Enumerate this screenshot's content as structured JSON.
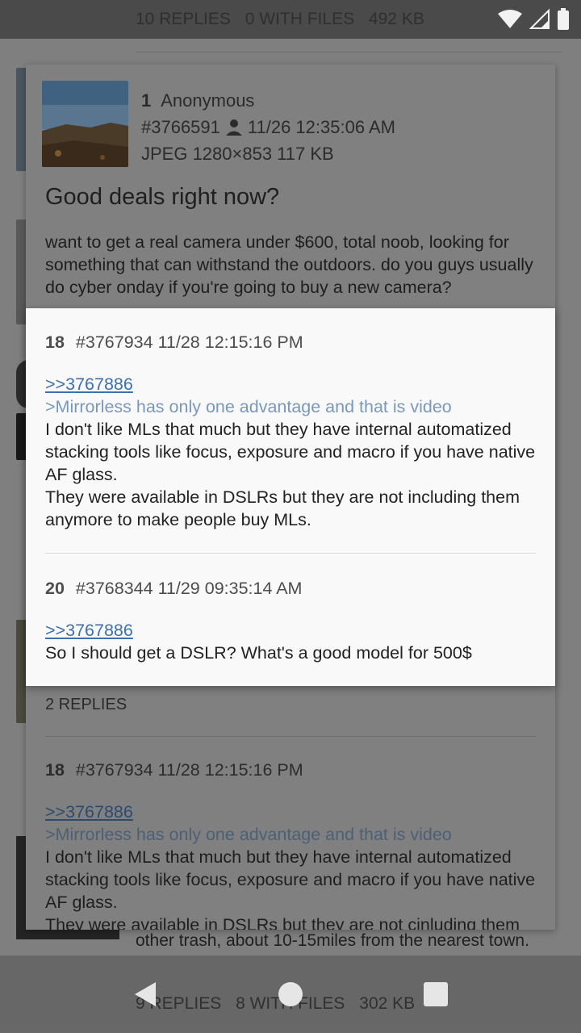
{
  "status_bar": {
    "thread_stats": {
      "replies": "10 REPLIES",
      "with_files": "0 WITH FILES",
      "size": "492 KB"
    },
    "icons": [
      "wifi-icon",
      "cell-signal-icon",
      "battery-icon"
    ]
  },
  "op_post": {
    "number": "1",
    "name": "Anonymous",
    "post_id": "#3766591",
    "datetime": "11/26 12:35:06 AM",
    "file_info": "JPEG 1280×853 117 KB",
    "subject": "Good deals right now?",
    "body": "want to get a real camera under $600, total noob, looking for something that can withstand the outdoors. do you guys usually do cyber onday if you're going to buy a new camera?"
  },
  "replies_dialog": {
    "replies_label": "2 REPLIES",
    "posts": [
      {
        "number": "18",
        "post_id": "#3767934",
        "datetime": "11/28 12:15:16 PM",
        "quote_link": ">>3767886",
        "greentext": ">Mirrorless has only one advantage and that is video",
        "text_1": "I don't like MLs that much but they have internal automatized stacking tools like focus, exposure and macro if you have native AF glass.",
        "text_2": "They were available in DSLRs but they are not cinluding them anymore to make people buy MLs."
      }
    ]
  },
  "popup": {
    "posts": [
      {
        "number": "18",
        "post_id": "#3767934",
        "datetime": "11/28 12:15:16 PM",
        "quote_link": ">>3767886",
        "greentext": ">Mirrorless has only one advantage and that is video",
        "text_1": "I don't like MLs that much but they have internal automatized stacking tools like focus, exposure and macro if you have native AF glass.",
        "text_2": "They were available in DSLRs but they are not including them anymore to make people buy MLs."
      },
      {
        "number": "20",
        "post_id": "#3768344",
        "datetime": "11/29 09:35:14 AM",
        "quote_link": ">>3767886",
        "text_1": "So I should get a DSLR? What's a good model for 500$"
      }
    ]
  },
  "background_thread": {
    "snippet": "other trash, about 10-15miles from the nearest town.",
    "stats": {
      "replies": "9 REPLIES",
      "with_files": "8 WITH FILES",
      "size": "302 KB"
    }
  },
  "nav_bar": {
    "buttons": [
      "back-icon",
      "home-icon",
      "recents-icon"
    ]
  }
}
